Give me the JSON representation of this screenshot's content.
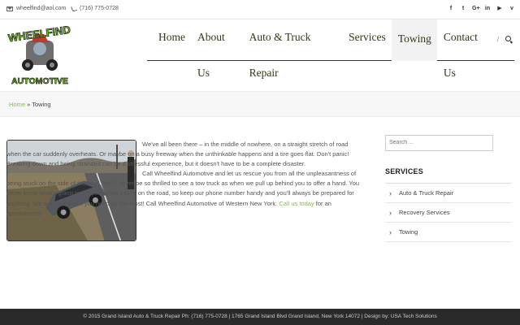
{
  "topbar": {
    "email": "wheelfind@aol.com",
    "phone": "(716) 775-0728",
    "socials": [
      {
        "icon": "facebook-icon",
        "glyph": "f"
      },
      {
        "icon": "twitter-icon",
        "glyph": "t"
      },
      {
        "icon": "google-plus-icon",
        "glyph": "G+"
      },
      {
        "icon": "linkedin-icon",
        "glyph": "in"
      },
      {
        "icon": "youtube-icon",
        "glyph": "▶"
      },
      {
        "icon": "vimeo-icon",
        "glyph": "v"
      }
    ]
  },
  "logo": {
    "line1": "WHEELFIND",
    "line2": "AUTOMOTIVE"
  },
  "nav": {
    "items": [
      {
        "label": "Home",
        "active": false
      },
      {
        "label": "About Us",
        "active": false
      },
      {
        "label": "Auto & Truck Repair",
        "active": false
      },
      {
        "label": "Services",
        "active": false
      },
      {
        "label": "Towing",
        "active": true
      },
      {
        "label": "Contact Us",
        "active": false
      }
    ],
    "separator": "/"
  },
  "breadcrumb": {
    "home": "Home",
    "sep": " » ",
    "current": "Towing"
  },
  "content": {
    "p1": "We've all been there – in the middle of nowhere, on a straight stretch of road when the car suddenly overheats. Or maybe on a busy freeway when the unthinkable happens and a tire goes flat. Don't panic! Breaking down and being stranded can be a stressful experience, but it doesn't have to be a complete disaster.",
    "p2": "Call Wheelfind Automotive and let us rescue you from all the unpleasantness of being stuck on the side of the road. You'll never be so thrilled to see a tow truck as when we pull up behind you to offer a hand. You never know what's going to happen when you're on the road, so keep our phone number handy and you'll always be prepared for anything. We are here when you need us the most! Call Wheelfind Automotive of Western New York.",
    "link": "Call us today",
    "p2_end": " for an appointment!"
  },
  "sidebar": {
    "search_placeholder": "Search ...",
    "title": "SERVICES",
    "items": [
      "Auto & Truck Repair",
      "Recovery Services",
      "Towing"
    ]
  },
  "footer": {
    "text": "© 2015 Grand Island Auto & Truck Repair Ph: (716) 775-0728  |  1765 Grand Island Blvd Grand Island, New York 14072  |  Design by: USA Tech Solutions"
  }
}
